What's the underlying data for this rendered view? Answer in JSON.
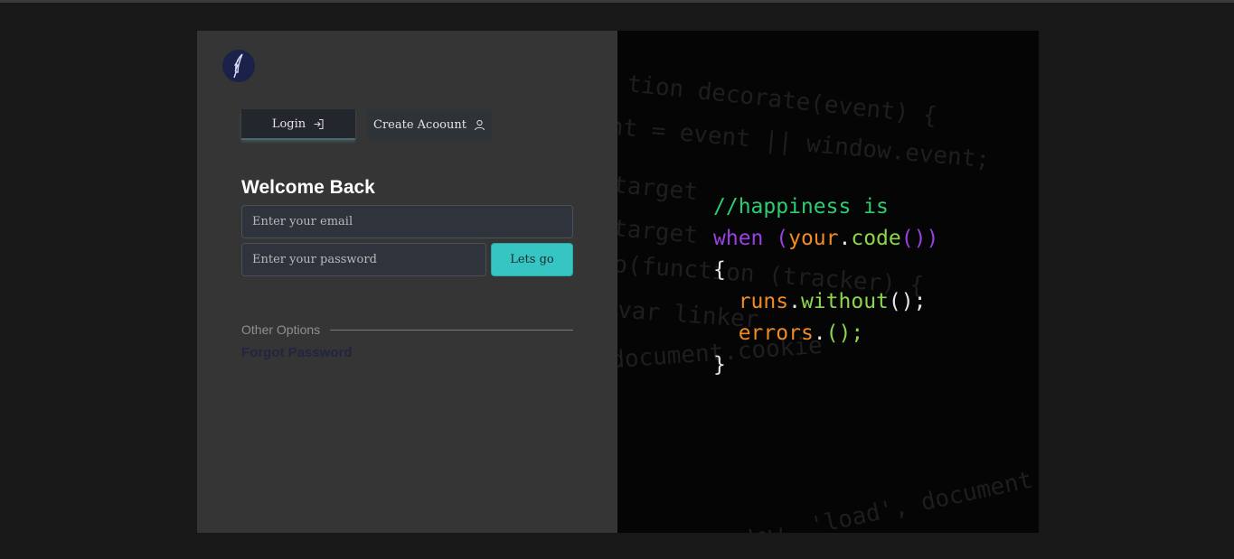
{
  "tabs": {
    "login_label": "Login",
    "create_label": "Create Acoount"
  },
  "form": {
    "heading": "Welcome Back",
    "email_placeholder": "Enter your email",
    "password_placeholder": "Enter your password",
    "submit_label": "Lets go"
  },
  "options": {
    "other_label": "Other Options",
    "forgot_label": "Forgot Password"
  },
  "hero": {
    "line1": "//happiness is",
    "line2_kw": "when",
    "line2_open": "(",
    "line2_obj": "your",
    "line2_dot": ".",
    "line2_fn": "code",
    "line2_close": "())",
    "line3": "{",
    "line4_obj": "runs",
    "line4_dot": ".",
    "line4_fn": "without",
    "line4_end": "();",
    "line5_obj": "errors",
    "line5_dot": ".",
    "line5_end": "();",
    "line6": "}"
  },
  "colors": {
    "accent": "#36c5c2",
    "logo_bg": "#1b2148",
    "comment": "#2ecc71",
    "keyword": "#9b3fe6",
    "object": "#f08a24"
  },
  "icons": {
    "logo": "quill-logo-icon",
    "login": "sign-in-icon",
    "create": "user-icon"
  }
}
